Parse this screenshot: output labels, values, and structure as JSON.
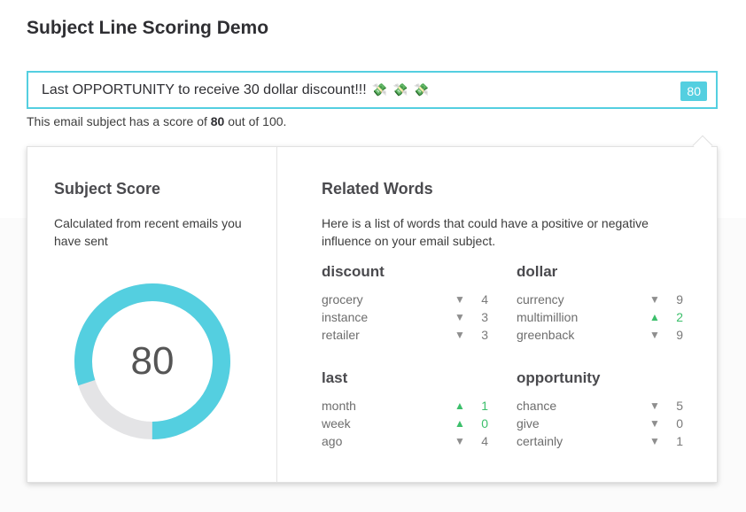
{
  "page": {
    "title": "Subject Line Scoring Demo"
  },
  "subject": {
    "value": "Last OPPORTUNITY to receive 30 dollar discount!!!",
    "emoji_icons": [
      "money-with-wings-icon",
      "money-with-wings-icon",
      "money-with-wings-icon"
    ],
    "score_badge": "80"
  },
  "score_line": {
    "prefix": "This email subject has a score of",
    "score": "80",
    "suffix": "out of 100."
  },
  "subject_score": {
    "heading": "Subject Score",
    "description": "Calculated from recent emails you have sent",
    "value": "80",
    "fraction": 0.8
  },
  "related_words": {
    "heading": "Related Words",
    "description": "Here is a list of words that could have a positive or negative influence on your email subject.",
    "groups": [
      {
        "title": "discount",
        "words": [
          {
            "word": "grocery",
            "direction": "down",
            "value": "4"
          },
          {
            "word": "instance",
            "direction": "down",
            "value": "3"
          },
          {
            "word": "retailer",
            "direction": "down",
            "value": "3"
          }
        ]
      },
      {
        "title": "dollar",
        "words": [
          {
            "word": "currency",
            "direction": "down",
            "value": "9"
          },
          {
            "word": "multimillion",
            "direction": "up",
            "value": "2"
          },
          {
            "word": "greenback",
            "direction": "down",
            "value": "9"
          }
        ]
      },
      {
        "title": "last",
        "words": [
          {
            "word": "month",
            "direction": "up",
            "value": "1"
          },
          {
            "word": "week",
            "direction": "up",
            "value": "0"
          },
          {
            "word": "ago",
            "direction": "down",
            "value": "4"
          }
        ]
      },
      {
        "title": "opportunity",
        "words": [
          {
            "word": "chance",
            "direction": "down",
            "value": "5"
          },
          {
            "word": "give",
            "direction": "down",
            "value": "0"
          },
          {
            "word": "certainly",
            "direction": "down",
            "value": "1"
          }
        ]
      }
    ]
  },
  "colors": {
    "accent": "#54cfe0",
    "gauge_track": "#e4e4e6",
    "positive": "#3cbf6b",
    "negative": "#8e8e8e"
  }
}
